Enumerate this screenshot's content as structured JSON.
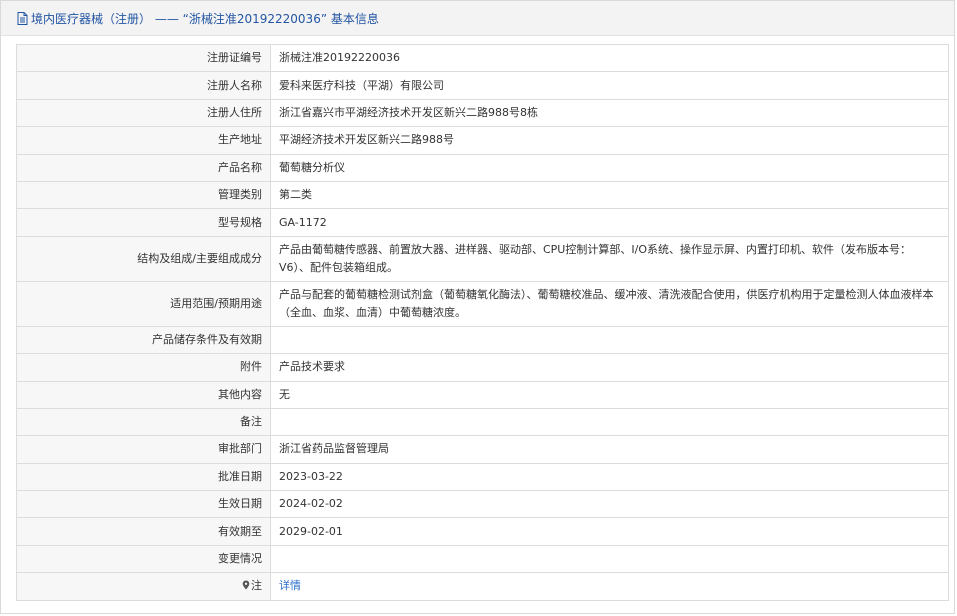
{
  "header": {
    "title": "境内医疗器械（注册） —— “浙械注准20192220036” 基本信息"
  },
  "rows": [
    {
      "label": "注册证编号",
      "value": "浙械注准20192220036"
    },
    {
      "label": "注册人名称",
      "value": "爱科来医疗科技（平湖）有限公司"
    },
    {
      "label": "注册人住所",
      "value": "浙江省嘉兴市平湖经济技术开发区新兴二路988号8栋"
    },
    {
      "label": "生产地址",
      "value": "平湖经济技术开发区新兴二路988号"
    },
    {
      "label": "产品名称",
      "value": "葡萄糖分析仪"
    },
    {
      "label": "管理类别",
      "value": "第二类"
    },
    {
      "label": "型号规格",
      "value": "GA-1172"
    },
    {
      "label": "结构及组成/主要组成成分",
      "value": "产品由葡萄糖传感器、前置放大器、进样器、驱动部、CPU控制计算部、I/O系统、操作显示屏、内置打印机、软件（发布版本号：V6）、配件包装箱组成。"
    },
    {
      "label": "适用范围/预期用途",
      "value": "产品与配套的葡萄糖检测试剂盒（葡萄糖氧化酶法）、葡萄糖校准品、缓冲液、清洗液配合使用，供医疗机构用于定量检测人体血液样本（全血、血浆、血清）中葡萄糖浓度。"
    },
    {
      "label": "产品储存条件及有效期",
      "value": ""
    },
    {
      "label": "附件",
      "value": "产品技术要求"
    },
    {
      "label": "其他内容",
      "value": "无"
    },
    {
      "label": "备注",
      "value": ""
    },
    {
      "label": "审批部门",
      "value": "浙江省药品监督管理局"
    },
    {
      "label": "批准日期",
      "value": "2023-03-22"
    },
    {
      "label": "生效日期",
      "value": "2024-02-02"
    },
    {
      "label": "有效期至",
      "value": "2029-02-01"
    },
    {
      "label": "变更情况",
      "value": ""
    }
  ],
  "note": {
    "label": "注",
    "link_text": "详情"
  },
  "colors": {
    "header_text": "#2255a4",
    "link": "#2a6fc9",
    "label_bg": "#f7f7f7",
    "border": "#dcdcdc"
  },
  "icons": {
    "header": "document-icon",
    "note": "pin-icon"
  }
}
